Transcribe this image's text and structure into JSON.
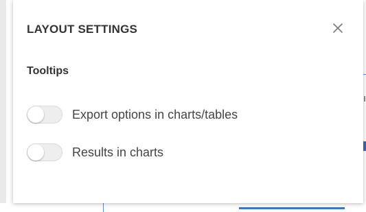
{
  "panel": {
    "title": "LAYOUT SETTINGS",
    "close_icon": "close-icon"
  },
  "tooltips": {
    "heading": "Tooltips",
    "options": [
      {
        "label": "Export options in charts/tables",
        "enabled": false
      },
      {
        "label": "Results in charts",
        "enabled": false
      }
    ]
  },
  "colors": {
    "panel_bg": "#ffffff",
    "text": "#333333",
    "toggle_off_track": "#eeeeee",
    "accent_blue": "#3b78c4"
  }
}
